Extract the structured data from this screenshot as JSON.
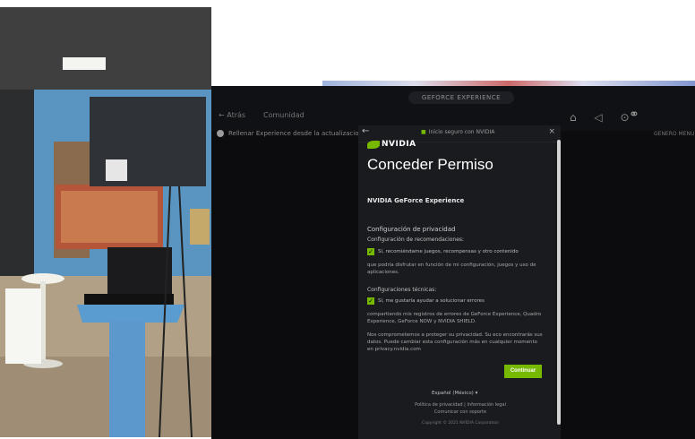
{
  "colors": {
    "accent": "#76b900",
    "background": "#0c0c0e",
    "dialog": "#1a1b1f"
  },
  "topbar": {
    "pill": "GEFORCE EXPERIENCE",
    "tab_left": "← Atrás",
    "tab_left2": "Comunidad",
    "right_icons": "⌂ ◁ ⊙",
    "headset_icon": "headset-icon"
  },
  "notice": "Rellenar Experience desde la actualizacion",
  "right_label": "GENERO MENU",
  "dialog": {
    "secure_label": "Inicio seguro con NVIDIA",
    "logo": "NVIDIA",
    "title": "Conceder Permiso",
    "app_name": "NVIDIA GeForce Experience",
    "privacy_heading": "Configuración de privacidad",
    "recs_heading": "Configuración de recomendaciones:",
    "recs_checkbox": "Sí, recomiéndame juegos, recompensas y otro contenido",
    "recs_body": "que podría disfrutar en función de mi configuración, juegos y uso de aplicaciones.",
    "tech_heading": "Configuraciones técnicas:",
    "tech_checkbox": "Sí, me gustaría ayudar a solucionar errores",
    "tech_body": "compartiendo mis registros de errores de GeForce Experience, Quadro Experience, GeForce NOW y NVIDIA SHIELD.",
    "privacy_body": "Nos comprometemos a proteger su privacidad. Su eco encontrarás sus datos. Puede cambiar esta configuración más en cualquier momento en privacy.nvidia.com",
    "continue_label": "Continuar",
    "language": "Español (México) ▾",
    "links1": "Política de privacidad  |  Información legal",
    "links2": "Comunicar con soporte",
    "copyright": "Copyright © 2021 NVIDIA Corporation"
  }
}
